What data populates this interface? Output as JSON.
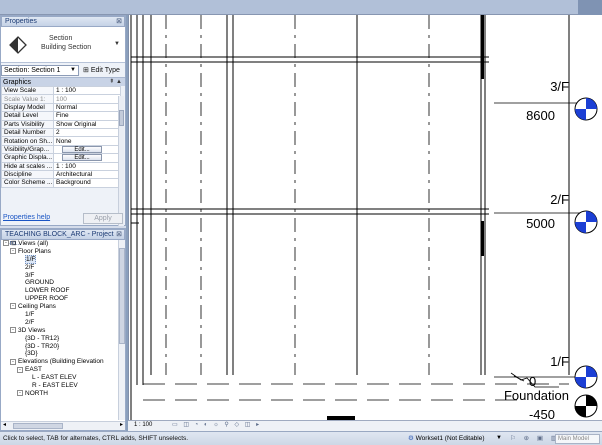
{
  "properties": {
    "title": "Properties",
    "type_name_line1": "Section",
    "type_name_line2": "Building Section",
    "instance_selector": "Section: Section 1",
    "edit_type": "Edit Type",
    "group": "Graphics",
    "rows": [
      {
        "key": "View Scale",
        "value": "1 : 100",
        "kind": "text"
      },
      {
        "key": "Scale Value    1:",
        "value": "100",
        "kind": "gray"
      },
      {
        "key": "Display Model",
        "value": "Normal",
        "kind": "text"
      },
      {
        "key": "Detail Level",
        "value": "Fine",
        "kind": "text"
      },
      {
        "key": "Parts Visibility",
        "value": "Show Original",
        "kind": "text"
      },
      {
        "key": "Detail Number",
        "value": "2",
        "kind": "text"
      },
      {
        "key": "Rotation on Sh...",
        "value": "None",
        "kind": "text"
      },
      {
        "key": "Visibility/Grap...",
        "value": "Edit...",
        "kind": "button"
      },
      {
        "key": "Graphic Displa...",
        "value": "Edit...",
        "kind": "button"
      },
      {
        "key": "Hide at scales ...",
        "value": "1 : 100",
        "kind": "text"
      },
      {
        "key": "Discipline",
        "value": "Architectural",
        "kind": "text"
      },
      {
        "key": "Color Scheme ...",
        "value": "Background",
        "kind": "text"
      }
    ],
    "help_link": "Properties help",
    "apply": "Apply"
  },
  "browser": {
    "title": "TEACHING BLOCK_ARC - Project Bro...",
    "tree": [
      {
        "label": "Views (all)",
        "depth": 0,
        "exp": "-",
        "icon": true
      },
      {
        "label": "Floor Plans",
        "depth": 1,
        "exp": "-"
      },
      {
        "label": "1/F",
        "depth": 2,
        "sel": true
      },
      {
        "label": "2/F",
        "depth": 2
      },
      {
        "label": "3/F",
        "depth": 2
      },
      {
        "label": "GROUND",
        "depth": 2
      },
      {
        "label": "LOWER ROOF",
        "depth": 2
      },
      {
        "label": "UPPER ROOF",
        "depth": 2
      },
      {
        "label": "Ceiling Plans",
        "depth": 1,
        "exp": "-"
      },
      {
        "label": "1/F",
        "depth": 2
      },
      {
        "label": "2/F",
        "depth": 2
      },
      {
        "label": "3D Views",
        "depth": 1,
        "exp": "-"
      },
      {
        "label": "{3D - TR12}",
        "depth": 2
      },
      {
        "label": "{3D - TR20}",
        "depth": 2
      },
      {
        "label": "{3D}",
        "depth": 2
      },
      {
        "label": "Elevations (Building Elevation",
        "depth": 1,
        "exp": "-"
      },
      {
        "label": "EAST",
        "depth": 2,
        "exp": "-"
      },
      {
        "label": "L - EAST ELEV",
        "depth": 3
      },
      {
        "label": "R - EAST ELEV",
        "depth": 3
      },
      {
        "label": "NORTH",
        "depth": 2,
        "exp": "-"
      }
    ]
  },
  "levels": [
    {
      "name": "3/F",
      "elevation": "8600"
    },
    {
      "name": "2/F",
      "elevation": "5000"
    },
    {
      "name": "1/F",
      "elevation": "0"
    },
    {
      "name": "Foundation",
      "elevation": "-450"
    }
  ],
  "viewbar": {
    "scale": "1 : 100",
    "icons": "▭ ◫ ◔ ◐ ☼ ⚲ ◇ ◫ ▸"
  },
  "status": {
    "text": "Click to select, TAB for alternates, CTRL adds, SHIFT unselects.",
    "workset": "Workset1 (Not Editable)",
    "model": "Main Model"
  },
  "colors": {
    "level_marker_blue": "#1c3fd4",
    "panel_bg": "#d4dcea",
    "title_text": "#1b3a73"
  }
}
